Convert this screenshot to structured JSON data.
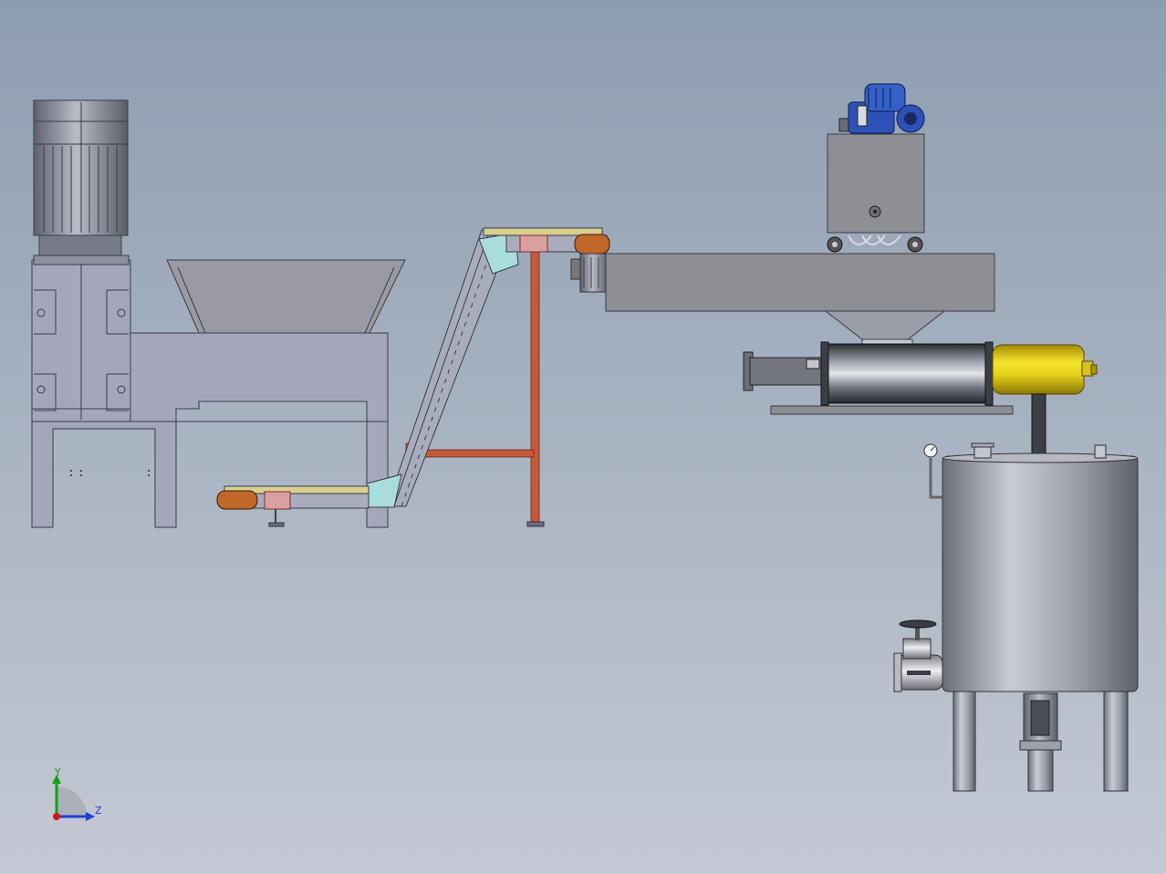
{
  "viewport": {
    "background_top": "#8d9db0",
    "background_bottom": "#c4c9d4"
  },
  "triad": {
    "y_label": "Y",
    "z_label": "Z",
    "y_color": "#16a01a",
    "z_color": "#1f3fd0",
    "origin_color": "#d01818"
  },
  "colors": {
    "steel_light": "#a4a7bc",
    "steel_mid": "#8a8c9c",
    "steel_dark": "#4d4f5c",
    "machine_grey": "#8e8f94",
    "hopper_grey": "#9a9aa3",
    "conveyor_yellow": "#d9cf8f",
    "conveyor_cyan": "#a9dcdc",
    "conveyor_orange": "#c0672a",
    "frame_red": "#b24a2a",
    "motor_blue": "#2c52b8",
    "barrel_yellow": "#e6d21b",
    "tank_grey": "#9d9fab"
  },
  "labels": {
    "valve_nameplate": ""
  }
}
